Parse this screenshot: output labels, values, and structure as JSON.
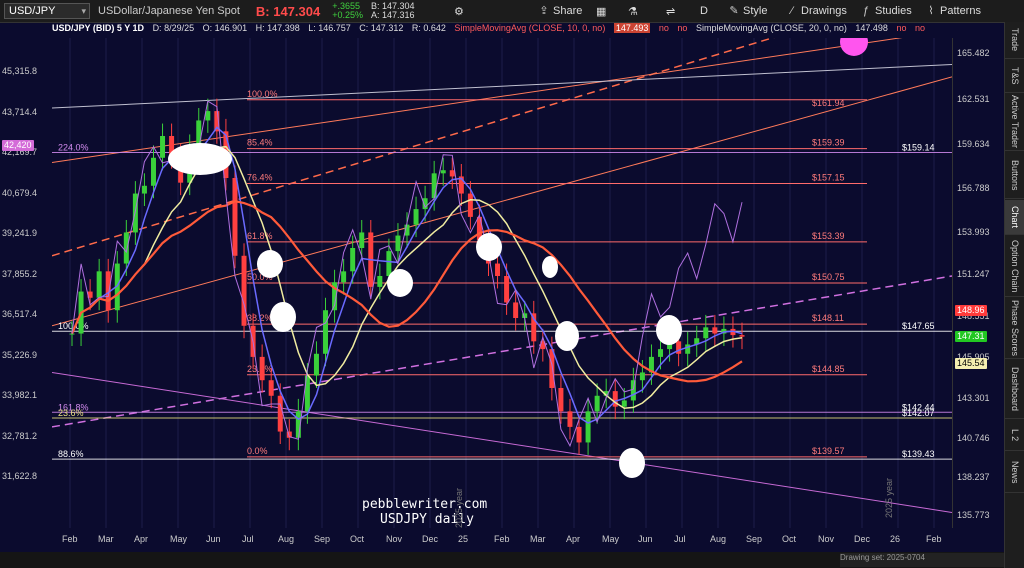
{
  "topbar": {
    "symbol": "USD/JPY",
    "desc": "USDollar/Japanese Yen Spot",
    "bid": "B: 147.304",
    "change": "+.3655",
    "change_pct": "+0.25%",
    "bid_small": "B: 147.304",
    "ask_small": "A: 147.316",
    "share": "Share",
    "period": "D",
    "style": "Style",
    "drawings": "Drawings",
    "studies": "Studies",
    "patterns": "Patterns"
  },
  "infobar": {
    "title": "USD/JPY (BID) 5 Y 1D",
    "date": "D: 8/29/25",
    "open": "O: 146.901",
    "high": "H: 147.398",
    "low": "L: 146.757",
    "close": "C: 147.312",
    "range": "R: 0.642",
    "sma10": "SimpleMovingAvg (CLOSE, 10, 0, no)",
    "sma10_val": "147.493",
    "no1": "no",
    "no2": "no",
    "sma20": "SimpleMovingAvg (CLOSE, 20, 0, no)",
    "sma20_val": "147.498",
    "no3": "no",
    "no4": "no"
  },
  "chart_data": {
    "type": "candlestick",
    "right_axis_ticks": [
      "165.482",
      "162.531",
      "159.634",
      "156.788",
      "153.993",
      "151.247",
      "148.551",
      "145.905",
      "143.301",
      "140.746",
      "138.237",
      "135.773"
    ],
    "left_axis_ticks": [
      "45,315.8",
      "43,714.4",
      "42,169.7",
      "40,679.4",
      "39,241.9",
      "37,855.2",
      "36,517.4",
      "35,226.9",
      "33,982.1",
      "32,781.2",
      "31,622.8"
    ],
    "left_axis_tag": "42,420",
    "x_labels": [
      "Feb",
      "Mar",
      "Apr",
      "May",
      "Jun",
      "Jul",
      "Aug",
      "Sep",
      "Oct",
      "Nov",
      "Dec",
      "25",
      "Feb",
      "Mar",
      "Apr",
      "May",
      "Jun",
      "Jul",
      "Aug",
      "Sep",
      "Oct",
      "Nov",
      "Dec",
      "26",
      "Feb"
    ],
    "fib_left": [
      {
        "label": "100.0%",
        "price": 162.53
      },
      {
        "label": "85.4%",
        "price": 159.39
      },
      {
        "label": "76.4%",
        "price": 157.15
      },
      {
        "label": "61.8%",
        "price": 153.39
      },
      {
        "label": "50.0%",
        "price": 150.75
      },
      {
        "label": "38.2%",
        "price": 148.11
      },
      {
        "label": "23.6%",
        "price": 144.85
      },
      {
        "label": "0.0%",
        "price": 139.57
      }
    ],
    "fib_right": [
      {
        "label": "$161.94",
        "price": 161.94
      },
      {
        "label": "$159.39",
        "price": 159.39
      },
      {
        "label": "$157.15",
        "price": 157.15
      },
      {
        "label": "$153.39",
        "price": 153.39
      },
      {
        "label": "$150.75",
        "price": 150.75
      },
      {
        "label": "$148.11",
        "price": 148.11
      },
      {
        "label": "$144.85",
        "price": 144.85
      },
      {
        "label": "$139.57",
        "price": 139.57
      }
    ],
    "extra_left": [
      {
        "label": "224.0%",
        "price": 159.14
      },
      {
        "label": "100.0%",
        "price": 147.65
      },
      {
        "label": "161.8%",
        "price": 142.44
      },
      {
        "label": "23.6%",
        "price": 142.07
      },
      {
        "label": "88.6%",
        "price": 139.43
      }
    ],
    "extra_right": [
      {
        "label": "$159.14",
        "price": 159.14
      },
      {
        "label": "$147.65",
        "price": 147.65
      },
      {
        "label": "$142.44",
        "price": 142.44
      },
      {
        "label": "$142.07",
        "price": 142.07
      },
      {
        "label": "$139.43",
        "price": 139.43
      }
    ],
    "price_tags": [
      {
        "label": "148.96",
        "price": 148.96,
        "bg": "#ff3b3b"
      },
      {
        "label": "147.31",
        "price": 147.31,
        "bg": "#22c822"
      },
      {
        "label": "145.54",
        "price": 145.54,
        "bg": "#f5efb0"
      }
    ],
    "close_series": [
      147.5,
      150.2,
      149.8,
      151.5,
      149.0,
      152.0,
      154.0,
      156.5,
      157.0,
      158.8,
      160.2,
      158.9,
      157.2,
      159.5,
      161.2,
      161.8,
      160.5,
      157.5,
      152.5,
      148.0,
      146.0,
      144.5,
      143.5,
      141.2,
      140.8,
      142.5,
      144.8,
      146.2,
      149.0,
      150.8,
      151.5,
      153.0,
      154.0,
      150.5,
      151.2,
      152.8,
      153.8,
      154.5,
      155.5,
      156.2,
      157.8,
      158.0,
      157.6,
      156.5,
      155.0,
      153.5,
      152.0,
      151.2,
      149.5,
      148.5,
      148.8,
      147.0,
      146.5,
      144.0,
      142.5,
      141.5,
      140.5,
      142.5,
      143.5,
      143.8,
      142.8,
      143.2,
      144.5,
      145.0,
      146.0,
      146.5,
      147.0,
      146.2,
      146.8,
      147.2,
      147.9,
      147.5,
      147.8,
      147.4,
      147.3
    ],
    "watermark": "pebblewriter.com",
    "watermark2": "USDJPY daily",
    "year_label": "2025 year",
    "year_label_left": "2025 year"
  },
  "rightpanel": {
    "tabs": [
      "Trade",
      "T&S",
      "Active Trader",
      "Buttons",
      "Chart",
      "Option Chain",
      "Phase Scores",
      "Dashboard",
      "L 2",
      "News"
    ]
  },
  "status": "Drawing set: 2025-0704"
}
